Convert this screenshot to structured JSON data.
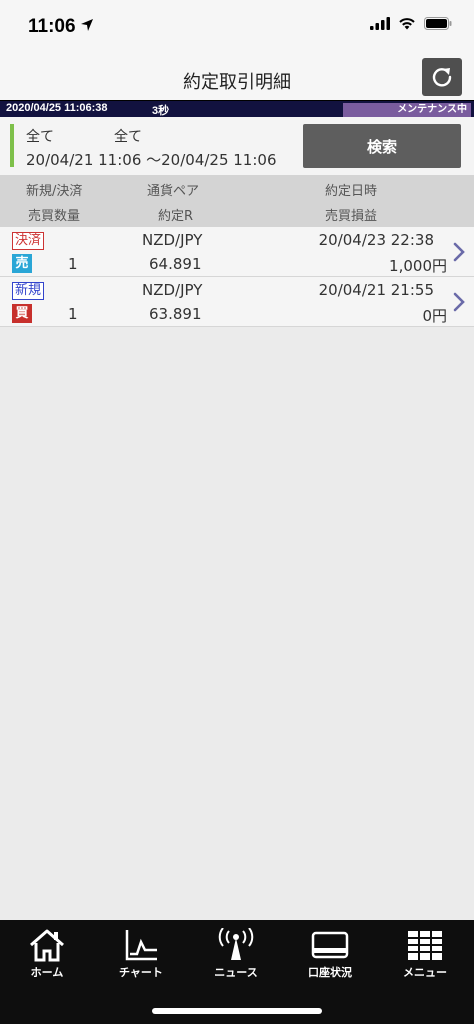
{
  "status": {
    "time": "11:06"
  },
  "nav": {
    "title": "約定取引明細"
  },
  "strip": {
    "datetime": "2020/04/25 11:06:38",
    "interval": "3秒",
    "maintenance": "メンテナンス中"
  },
  "filter": {
    "type": "全て",
    "pair": "全て",
    "range": "20/04/21 11:06 ～20/04/25 11:06",
    "search_label": "検索"
  },
  "table": {
    "headers": {
      "new_close": "新規/決済",
      "pair": "通貨ペア",
      "exec_datetime": "約定日時",
      "quantity": "売買数量",
      "exec_rate": "約定R",
      "profit_loss": "売買損益"
    },
    "rows": [
      {
        "tag": "決済",
        "side": "売",
        "quantity": "1",
        "pair": "NZD/JPY",
        "rate": "64.891",
        "datetime": "20/04/23 22:38",
        "pl": "1,000円"
      },
      {
        "tag": "新規",
        "side": "買",
        "quantity": "1",
        "pair": "NZD/JPY",
        "rate": "63.891",
        "datetime": "20/04/21 21:55",
        "pl": "0円"
      }
    ]
  },
  "tabs": [
    {
      "label": "ホーム",
      "icon": "home-icon"
    },
    {
      "label": "チャート",
      "icon": "chart-icon"
    },
    {
      "label": "ニュース",
      "icon": "news-antenna-icon"
    },
    {
      "label": "口座状況",
      "icon": "account-card-icon"
    },
    {
      "label": "メニュー",
      "icon": "menu-grid-icon"
    }
  ],
  "colors": {
    "accent_bar": "#7ec04a",
    "strip_bg": "#12123f",
    "maintenance_bg": "#7a5c9e",
    "sell": "#2aa6d6",
    "buy": "#c7302c"
  }
}
